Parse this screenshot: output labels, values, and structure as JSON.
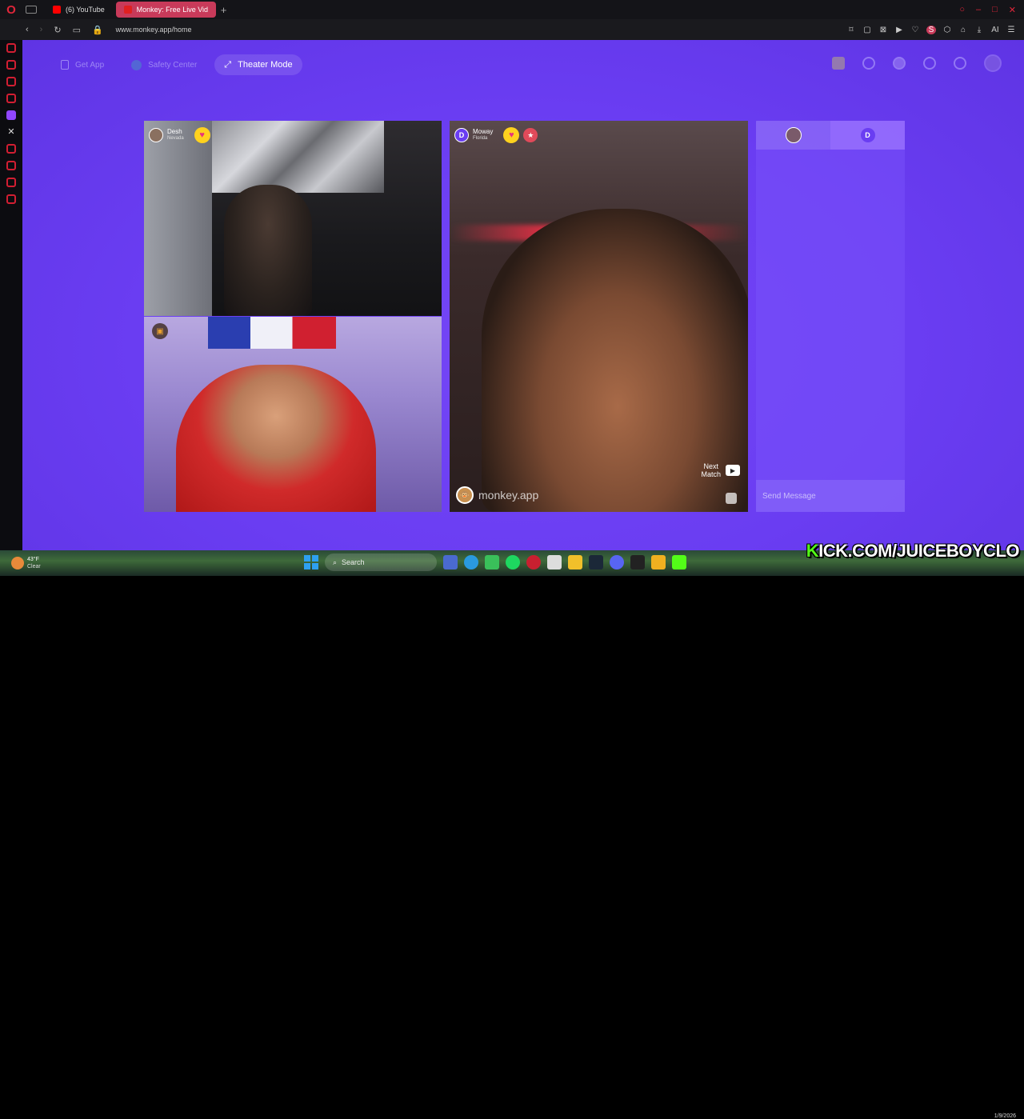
{
  "browser": {
    "tabs": [
      {
        "label": "(6) YouTube"
      },
      {
        "label": "Monkey: Free Live Vid"
      }
    ],
    "url": "www.monkey.app/home"
  },
  "nav": {
    "get_app": "Get App",
    "safety_center": "Safety Center",
    "theater_mode": "Theater Mode"
  },
  "video_top_left": {
    "name": "Desh",
    "location": "Nevada"
  },
  "video_main": {
    "initial": "D",
    "name": "Moway",
    "location": "Florida",
    "next_match_line1": "Next",
    "next_match_line2": "Match",
    "watermark": "monkey.app"
  },
  "chat": {
    "partner_initial": "D",
    "placeholder": "Send Message"
  },
  "taskbar": {
    "temperature": "43°F",
    "condition": "Clear",
    "search": "Search",
    "date": "1/9/2026"
  },
  "overlay": {
    "kick_k": "K",
    "kick_rest": "ICK.COM/JUICEBOYCLO"
  },
  "colors": {
    "background": "#6a3df2",
    "heart": "#ffd21e",
    "kick_green": "#53fc18"
  }
}
